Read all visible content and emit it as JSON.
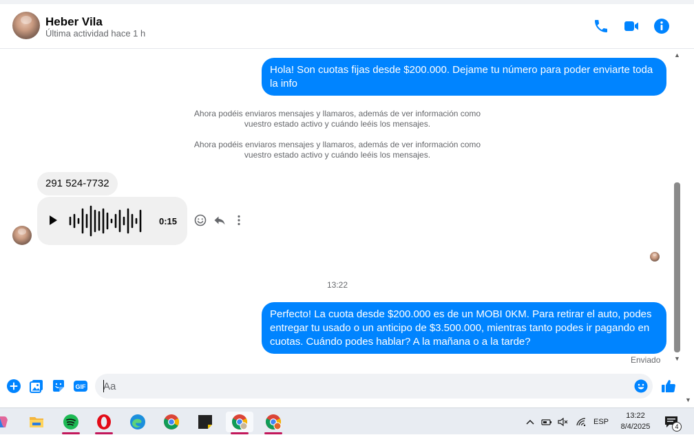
{
  "contact": {
    "name": "Heber Vila",
    "status": "Última actividad hace 1 h"
  },
  "messages": {
    "outgoing_1": "Hola! Son cuotas fijas desde $200.000. Dejame tu número para poder enviarte toda la info",
    "system_1": "Ahora podéis enviaros mensajes y llamaros, además de ver información como vuestro estado activo y cuándo leéis los mensajes.",
    "system_2": "Ahora podéis enviaros mensajes y llamaros, además de ver información como vuestro estado activo y cuándo leéis los mensajes.",
    "incoming_phone": "291 524-7732",
    "audio_duration": "0:15",
    "timestamp": "13:22",
    "outgoing_2": "Perfecto! La cuota desde $200.000 es de un MOBI 0KM. Para retirar el auto, podes entregar tu usado o un anticipo de $3.500.000, mientras tanto podes ir pagando en cuotas. Cuándo podes hablar? A la mañana o a la tarde?",
    "delivery_status": "Enviado"
  },
  "composer": {
    "placeholder": "Aa",
    "gif_label": "GIF"
  },
  "taskbar": {
    "apps": [
      "copilot-icon",
      "file-explorer-icon",
      "spotify-icon",
      "opera-icon",
      "edge-icon",
      "chrome-icon",
      "sticky-notes-icon",
      "chrome-profile-icon",
      "chrome-profile-icon"
    ],
    "language": "ESP",
    "time": "13:22",
    "date": "8/4/2025",
    "notification_count": "4"
  },
  "colors": {
    "accent": "#0084ff",
    "incoming_bubble": "#f0f0f0",
    "secondary_text": "#65676b",
    "taskbar": "#e8ecf2"
  }
}
